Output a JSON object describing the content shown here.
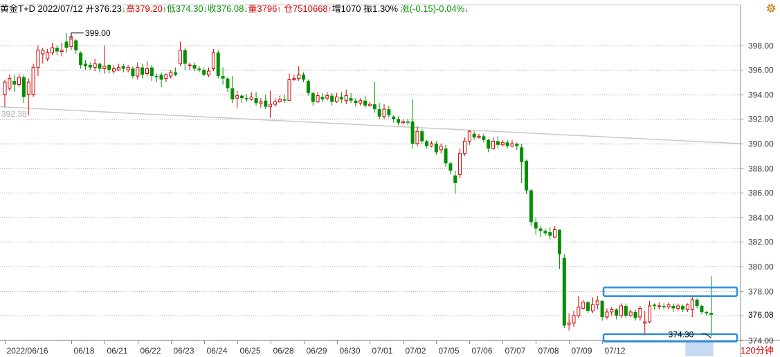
{
  "header": {
    "name": "黄金T+D",
    "date": "2022/07/12",
    "open_label": "开",
    "open": "376.23",
    "open_arrow": "↓",
    "high_label": "高",
    "high": "379.20",
    "high_arrow": "↑",
    "low_label": "低",
    "low": "374.30",
    "low_arrow": "↓",
    "close_label": "收",
    "close": "376.08",
    "close_arrow": "↓",
    "volume_label": "量",
    "volume": "3796",
    "volume_arrow": "↑",
    "position_label": "仓",
    "position": "7510668",
    "position_arrow": "↑",
    "increase_label": "增",
    "increase": "1070",
    "amplitude_label": "振",
    "amplitude": "1.30%",
    "change_label": "涨",
    "change": "(-0.15)-0.04%",
    "change_arrow": "↓"
  },
  "period_label": "120分钟",
  "colors": {
    "up": "#d10000",
    "down": "#009000",
    "grid": "#999999",
    "trendline": "#c8c8c8",
    "highlight_box": "#2a8fe6",
    "axis_highlight": "#c7daf2"
  },
  "icons": {
    "settings": "gear-icon"
  },
  "chart_data": {
    "type": "candlestick",
    "ylim": [
      373.3,
      401.2
    ],
    "yticks": [
      {
        "value": 398,
        "label": "398.00"
      },
      {
        "value": 396,
        "label": "396.00"
      },
      {
        "value": 394,
        "label": "394.00"
      },
      {
        "value": 392,
        "label": "392.00"
      },
      {
        "value": 390,
        "label": "390.00"
      },
      {
        "value": 388,
        "label": "388.00"
      },
      {
        "value": 386,
        "label": "386.00"
      },
      {
        "value": 384,
        "label": "384.00"
      },
      {
        "value": 382,
        "label": "382.00"
      },
      {
        "value": 380,
        "label": "380.00"
      },
      {
        "value": 378,
        "label": "378.00"
      },
      {
        "value": 376,
        "label": "376.00"
      },
      {
        "value": 374,
        "label": "374.00"
      }
    ],
    "xticks": [
      {
        "index": 0,
        "label": "2022/06/16"
      },
      {
        "index": 14,
        "label": "06/18"
      },
      {
        "index": 21,
        "label": "06/21"
      },
      {
        "index": 28,
        "label": "06/22"
      },
      {
        "index": 35,
        "label": "06/23"
      },
      {
        "index": 42,
        "label": "06/24"
      },
      {
        "index": 49,
        "label": "06/25"
      },
      {
        "index": 56,
        "label": "06/28"
      },
      {
        "index": 63,
        "label": "06/29"
      },
      {
        "index": 70,
        "label": "06/30"
      },
      {
        "index": 77,
        "label": "07/01"
      },
      {
        "index": 84,
        "label": "07/02"
      },
      {
        "index": 91,
        "label": "07/05"
      },
      {
        "index": 98,
        "label": "07/06"
      },
      {
        "index": 105,
        "label": "07/07"
      },
      {
        "index": 112,
        "label": "07/08"
      },
      {
        "index": 119,
        "label": "07/09"
      },
      {
        "index": 126,
        "label": "07/12"
      }
    ],
    "current_price": {
      "value": 376.08,
      "label": "376.08"
    },
    "max_annotation": {
      "value": 399.0,
      "label": "399.00"
    },
    "min_annotation": {
      "value": 374.3,
      "label": "374.30"
    },
    "crosshair_label": "392.38",
    "trendline": {
      "start": 393.0,
      "end": 390.0
    },
    "highlight_boxes": [
      {
        "low": 377.6,
        "high": 378.3
      },
      {
        "low": 373.9,
        "high": 374.5
      }
    ],
    "candles": [
      [
        394.0,
        395.0,
        393.0,
        395.2
      ],
      [
        394.5,
        395.3,
        394.3,
        395.6
      ],
      [
        395.1,
        394.8,
        394.2,
        395.6
      ],
      [
        394.8,
        395.4,
        394.6,
        395.7
      ],
      [
        395.4,
        393.8,
        393.3,
        395.6
      ],
      [
        394.0,
        395.0,
        392.3,
        395.3
      ],
      [
        394.0,
        396.2,
        393.8,
        396.5
      ],
      [
        396.2,
        397.6,
        395.5,
        398.0
      ],
      [
        397.3,
        397.6,
        396.5,
        397.8
      ],
      [
        396.9,
        397.4,
        396.7,
        397.7
      ],
      [
        397.4,
        397.8,
        397.2,
        398.2
      ],
      [
        397.8,
        397.5,
        397.2,
        398.0
      ],
      [
        397.5,
        397.6,
        397.1,
        398.2
      ],
      [
        398.3,
        397.8,
        397.4,
        399.0
      ],
      [
        397.9,
        398.7,
        397.6,
        399.0
      ],
      [
        398.4,
        397.6,
        397.3,
        398.5
      ],
      [
        397.4,
        396.4,
        396.1,
        397.5
      ],
      [
        396.5,
        396.3,
        396.0,
        396.8
      ],
      [
        396.4,
        396.2,
        396.0,
        396.6
      ],
      [
        396.2,
        396.5,
        395.9,
        396.9
      ],
      [
        396.5,
        396.1,
        395.8,
        396.6
      ],
      [
        396.1,
        396.3,
        395.7,
        398.0
      ],
      [
        396.4,
        396.0,
        395.7,
        396.5
      ],
      [
        395.9,
        396.1,
        395.7,
        396.4
      ],
      [
        396.0,
        396.2,
        395.9,
        396.5
      ],
      [
        396.3,
        396.1,
        395.8,
        396.5
      ],
      [
        396.0,
        396.2,
        395.8,
        396.4
      ],
      [
        396.1,
        395.5,
        395.3,
        396.3
      ],
      [
        395.5,
        396.2,
        395.2,
        396.6
      ],
      [
        396.2,
        395.6,
        395.3,
        396.5
      ],
      [
        395.7,
        396.1,
        395.5,
        396.7
      ],
      [
        396.2,
        395.5,
        395.1,
        396.4
      ],
      [
        395.5,
        395.4,
        395.0,
        395.7
      ],
      [
        395.6,
        395.2,
        394.6,
        395.8
      ],
      [
        395.3,
        395.6,
        395.0,
        395.7
      ],
      [
        395.5,
        395.8,
        395.3,
        396.0
      ],
      [
        395.8,
        395.6,
        395.5,
        396.2
      ],
      [
        396.5,
        397.6,
        396.3,
        398.3
      ],
      [
        397.6,
        396.5,
        396.0,
        397.8
      ],
      [
        396.4,
        396.4,
        396.0,
        396.6
      ],
      [
        396.4,
        396.1,
        395.9,
        396.6
      ],
      [
        396.1,
        396.0,
        395.8,
        396.3
      ],
      [
        396.0,
        395.6,
        395.5,
        396.2
      ],
      [
        395.6,
        395.9,
        395.4,
        396.2
      ],
      [
        396.1,
        397.4,
        395.9,
        397.7
      ],
      [
        397.4,
        395.5,
        395.3,
        397.6
      ],
      [
        395.5,
        395.3,
        394.8,
        396.2
      ],
      [
        395.3,
        394.5,
        394.2,
        395.4
      ],
      [
        394.5,
        393.6,
        393.3,
        395.5
      ],
      [
        393.7,
        393.9,
        392.9,
        394.3
      ],
      [
        393.9,
        393.7,
        393.3,
        394.0
      ],
      [
        393.7,
        393.6,
        393.4,
        394.0
      ],
      [
        393.6,
        393.8,
        393.5,
        394.2
      ],
      [
        393.7,
        393.3,
        393.1,
        394.2
      ],
      [
        393.3,
        393.4,
        392.9,
        393.7
      ],
      [
        393.5,
        393.0,
        392.8,
        394.0
      ],
      [
        393.0,
        393.2,
        392.1,
        394.3
      ],
      [
        393.2,
        393.4,
        393.0,
        393.7
      ],
      [
        393.4,
        393.6,
        393.3,
        393.9
      ],
      [
        393.6,
        393.5,
        393.3,
        394.0
      ],
      [
        393.5,
        395.2,
        395.0,
        395.7
      ],
      [
        395.2,
        395.3,
        395.1,
        395.6
      ],
      [
        395.3,
        395.6,
        395.1,
        396.3
      ],
      [
        395.6,
        395.2,
        395.0,
        395.8
      ],
      [
        395.1,
        394.1,
        393.9,
        395.2
      ],
      [
        394.1,
        393.4,
        393.1,
        394.2
      ],
      [
        393.4,
        393.9,
        393.3,
        394.2
      ],
      [
        393.8,
        393.6,
        393.4,
        394.1
      ],
      [
        393.7,
        393.9,
        393.5,
        394.2
      ],
      [
        393.9,
        393.4,
        393.1,
        394.1
      ],
      [
        393.4,
        393.8,
        393.3,
        394.1
      ],
      [
        393.8,
        393.6,
        393.3,
        394.2
      ],
      [
        393.5,
        393.9,
        393.2,
        394.4
      ],
      [
        393.7,
        393.5,
        393.3,
        394.1
      ],
      [
        393.5,
        393.3,
        393.0,
        393.7
      ],
      [
        393.3,
        393.5,
        393.1,
        393.7
      ],
      [
        393.5,
        393.1,
        392.9,
        393.9
      ],
      [
        393.1,
        393.2,
        393.0,
        393.4
      ],
      [
        393.2,
        392.8,
        392.5,
        395.0
      ],
      [
        392.8,
        392.2,
        392.0,
        393.3
      ],
      [
        392.2,
        392.8,
        392.0,
        393.2
      ],
      [
        392.8,
        392.3,
        392.1,
        393.1
      ],
      [
        392.2,
        392.0,
        391.7,
        392.3
      ],
      [
        392.0,
        391.7,
        391.5,
        392.2
      ],
      [
        391.7,
        391.8,
        391.6,
        392.0
      ],
      [
        391.8,
        391.7,
        391.5,
        392.0
      ],
      [
        391.8,
        390.0,
        389.6,
        393.6
      ],
      [
        390.0,
        391.0,
        389.8,
        391.4
      ],
      [
        391.0,
        390.2,
        390.0,
        391.2
      ],
      [
        390.2,
        389.8,
        389.6,
        390.3
      ],
      [
        389.8,
        390.0,
        389.7,
        390.2
      ],
      [
        390.0,
        389.3,
        389.1,
        390.2
      ],
      [
        389.5,
        389.8,
        389.2,
        390.0
      ],
      [
        389.6,
        388.4,
        388.1,
        389.9
      ],
      [
        388.4,
        387.8,
        387.5,
        388.5
      ],
      [
        387.4,
        386.8,
        385.9,
        387.8
      ],
      [
        387.5,
        389.2,
        387.2,
        389.6
      ],
      [
        389.2,
        390.2,
        389.0,
        390.5
      ],
      [
        390.2,
        391.0,
        389.9,
        391.1
      ],
      [
        390.8,
        390.5,
        390.3,
        391.0
      ],
      [
        390.5,
        390.6,
        390.4,
        390.8
      ],
      [
        390.6,
        390.3,
        390.1,
        390.8
      ],
      [
        390.3,
        389.6,
        389.3,
        390.4
      ],
      [
        389.6,
        390.2,
        389.5,
        390.5
      ],
      [
        390.2,
        389.9,
        389.6,
        390.6
      ],
      [
        389.9,
        390.1,
        389.8,
        390.3
      ],
      [
        390.1,
        389.8,
        389.6,
        390.3
      ],
      [
        389.8,
        390.0,
        389.7,
        390.3
      ],
      [
        390.0,
        389.8,
        389.5,
        390.1
      ],
      [
        389.7,
        388.5,
        386.8,
        390.0
      ],
      [
        388.6,
        386.2,
        385.9,
        388.7
      ],
      [
        386.2,
        383.6,
        383.3,
        386.3
      ],
      [
        383.6,
        383.1,
        382.6,
        384.0
      ],
      [
        383.1,
        382.9,
        382.4,
        383.3
      ],
      [
        382.9,
        382.7,
        382.5,
        383.1
      ],
      [
        382.8,
        382.5,
        382.2,
        383.2
      ],
      [
        382.4,
        383.0,
        382.3,
        383.3
      ],
      [
        383.0,
        381.0,
        379.8,
        383.0
      ],
      [
        380.7,
        375.2,
        375.0,
        381.0
      ],
      [
        375.3,
        375.4,
        374.8,
        376.2
      ],
      [
        375.4,
        376.0,
        375.1,
        376.4
      ],
      [
        376.0,
        376.7,
        375.8,
        377.6
      ],
      [
        376.6,
        377.1,
        376.5,
        377.3
      ],
      [
        377.1,
        376.4,
        376.2,
        377.2
      ],
      [
        376.4,
        376.9,
        376.2,
        377.5
      ],
      [
        376.9,
        377.2,
        376.5,
        377.6
      ],
      [
        377.2,
        375.9,
        375.6,
        377.3
      ],
      [
        375.9,
        376.3,
        375.7,
        376.6
      ],
      [
        376.3,
        376.5,
        376.0,
        376.7
      ],
      [
        376.5,
        376.0,
        375.7,
        376.6
      ],
      [
        376.0,
        376.8,
        375.8,
        377.0
      ],
      [
        376.8,
        376.0,
        375.8,
        377.0
      ],
      [
        376.0,
        376.3,
        375.9,
        376.5
      ],
      [
        376.3,
        375.8,
        375.6,
        376.5
      ],
      [
        375.9,
        376.6,
        375.6,
        376.8
      ],
      [
        375.4,
        375.5,
        374.4,
        376.4
      ],
      [
        375.5,
        376.8,
        375.4,
        377.2
      ],
      [
        376.9,
        376.8,
        376.5,
        377.0
      ],
      [
        376.8,
        376.8,
        376.5,
        377.1
      ],
      [
        376.8,
        376.7,
        376.5,
        377.0
      ],
      [
        376.7,
        376.9,
        376.5,
        377.1
      ],
      [
        376.8,
        376.6,
        376.3,
        377.0
      ],
      [
        376.6,
        376.8,
        376.4,
        377.0
      ],
      [
        376.8,
        376.5,
        376.3,
        376.9
      ],
      [
        376.5,
        376.9,
        376.3,
        377.0
      ],
      [
        376.5,
        377.3,
        375.9,
        377.6
      ],
      [
        377.3,
        376.8,
        376.6,
        377.4
      ],
      [
        376.8,
        376.3,
        376.1,
        376.9
      ],
      [
        376.3,
        376.2,
        376.0,
        376.4
      ],
      [
        376.23,
        376.08,
        374.3,
        379.2
      ]
    ]
  }
}
